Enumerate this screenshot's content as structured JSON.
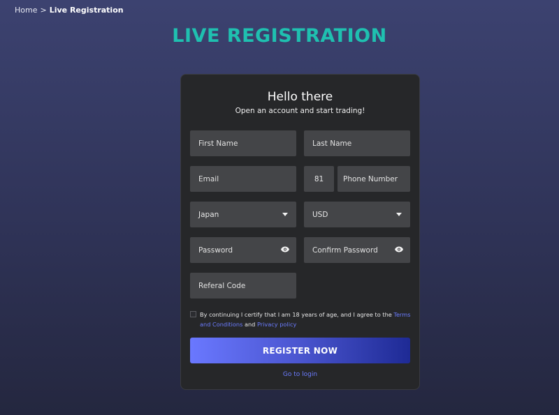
{
  "breadcrumb": {
    "home": "Home",
    "separator": ">",
    "current": "Live Registration"
  },
  "page_title": "LIVE REGISTRATION",
  "card": {
    "heading": "Hello there",
    "subheading": "Open an account and start trading!"
  },
  "form": {
    "first_name_placeholder": "First Name",
    "last_name_placeholder": "Last Name",
    "email_placeholder": "Email",
    "phone_code_value": "81",
    "phone_placeholder": "Phone Number",
    "country_value": "Japan",
    "currency_value": "USD",
    "password_placeholder": "Password",
    "confirm_password_placeholder": "Confirm Password",
    "referral_placeholder": "Referal Code"
  },
  "consent": {
    "text_before": "By continuing I certify that I am 18 years of age, and I agree to the",
    "terms_link": "Terms and Conditions",
    "and_text": "and",
    "privacy_link": "Privacy policy"
  },
  "register_button": "REGISTER NOW",
  "login_link": "Go to login",
  "colors": {
    "title_accent": "#1fc0b0",
    "link": "#6b7cff",
    "card_bg": "#262729",
    "field_bg": "#444548",
    "button_gradient_start": "#6a78ff",
    "button_gradient_end": "#1e2a95"
  }
}
